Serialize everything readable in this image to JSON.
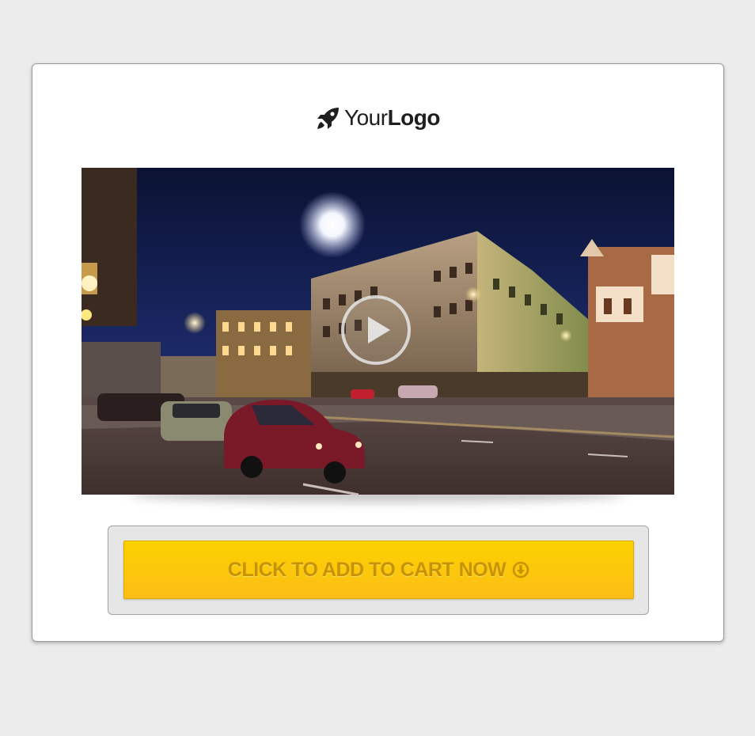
{
  "logo": {
    "icon": "rocket-icon",
    "text_light": "Your",
    "text_bold": "Logo"
  },
  "video": {
    "thumbnail": "night-city-street-photo",
    "play_icon": "play-icon"
  },
  "cta": {
    "label": "CLICK TO ADD TO CART NOW",
    "icon": "arrow-down-circle-icon",
    "color_top": "#fbd200",
    "color_bottom": "#fcbd17",
    "text_color": "#c79306"
  },
  "colors": {
    "page_background": "#ececed",
    "card_background": "#ffffff"
  }
}
